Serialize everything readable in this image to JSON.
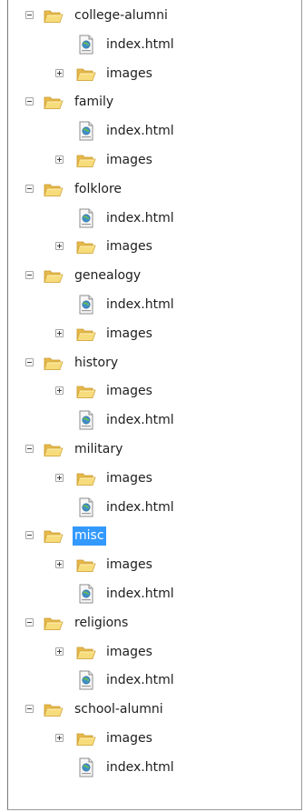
{
  "tree": {
    "groups": [
      {
        "name": "college-alumni",
        "children": [
          {
            "kind": "file",
            "label": "index.html"
          },
          {
            "kind": "folder",
            "label": "images"
          }
        ]
      },
      {
        "name": "family",
        "children": [
          {
            "kind": "file",
            "label": "index.html"
          },
          {
            "kind": "folder",
            "label": "images"
          }
        ]
      },
      {
        "name": "folklore",
        "children": [
          {
            "kind": "file",
            "label": "index.html"
          },
          {
            "kind": "folder",
            "label": "images"
          }
        ]
      },
      {
        "name": "genealogy",
        "children": [
          {
            "kind": "file",
            "label": "index.html"
          },
          {
            "kind": "folder",
            "label": "images"
          }
        ]
      },
      {
        "name": "history",
        "children": [
          {
            "kind": "folder",
            "label": "images"
          },
          {
            "kind": "file",
            "label": "index.html"
          }
        ]
      },
      {
        "name": "military",
        "children": [
          {
            "kind": "folder",
            "label": "images"
          },
          {
            "kind": "file",
            "label": "index.html"
          }
        ]
      },
      {
        "name": "misc",
        "selected": true,
        "children": [
          {
            "kind": "folder",
            "label": "images"
          },
          {
            "kind": "file",
            "label": "index.html"
          }
        ]
      },
      {
        "name": "religions",
        "children": [
          {
            "kind": "folder",
            "label": "images"
          },
          {
            "kind": "file",
            "label": "index.html"
          }
        ]
      },
      {
        "name": "school-alumni",
        "children": [
          {
            "kind": "folder",
            "label": "images"
          },
          {
            "kind": "file",
            "label": "index.html"
          }
        ]
      }
    ]
  },
  "icons": {
    "expanded_toggle": "minus-box-icon",
    "collapsed_toggle": "plus-box-icon",
    "folder": "folder-icon",
    "file": "html-document-icon"
  },
  "colors": {
    "selection_bg": "#3399ff",
    "selection_text": "#ffffff",
    "folder_yellow": "#f2d36a"
  }
}
